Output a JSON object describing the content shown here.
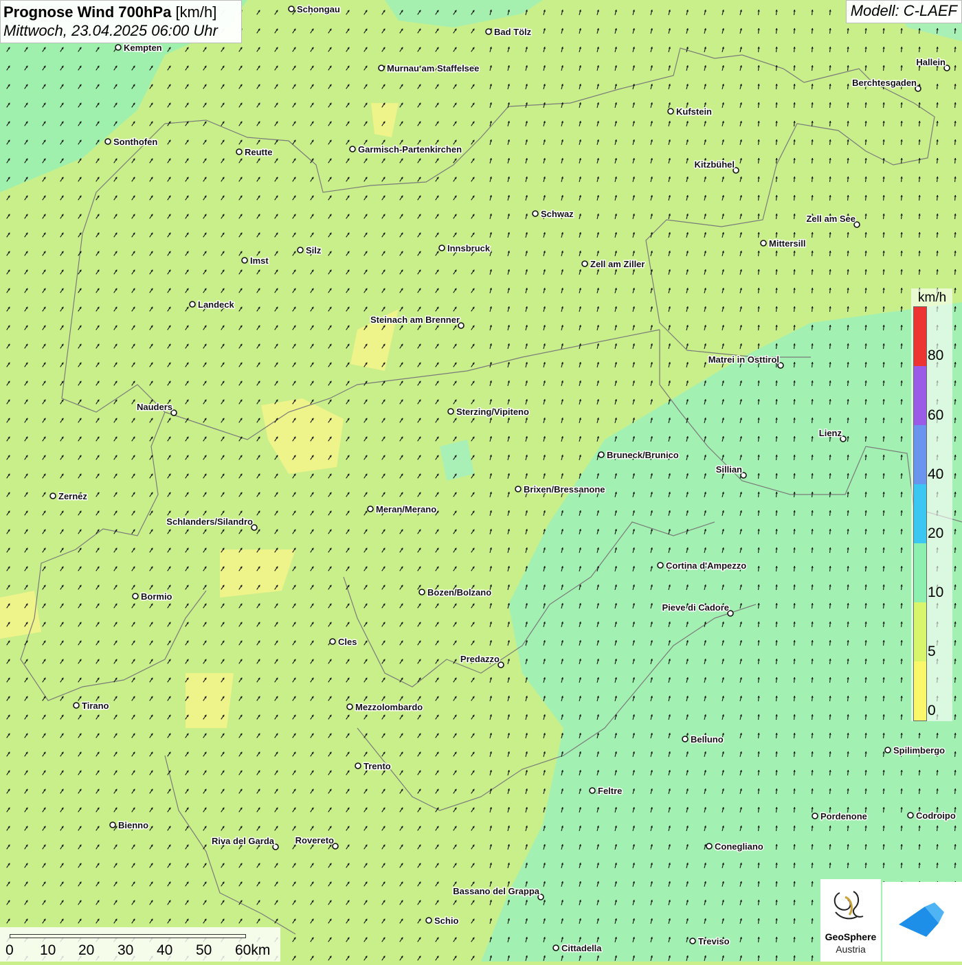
{
  "title": {
    "main_bold": "Prognose Wind 700hPa",
    "main_unit": "[km/h]",
    "datetime": "Mittwoch, 23.04.2025 06:00 Uhr"
  },
  "model": "Modell: C-LAEF",
  "legend": {
    "unit": "km/h",
    "ticks": [
      "80",
      "60",
      "40",
      "20",
      "10",
      "5",
      "0"
    ],
    "colors": [
      "#ee3333",
      "#9a5ce8",
      "#6a94ee",
      "#3cc6f2",
      "#8ef0b0",
      "#d8f56c",
      "#fbf76a"
    ]
  },
  "scale": {
    "labels": [
      "0",
      "10",
      "20",
      "30",
      "40",
      "50",
      "60km"
    ]
  },
  "cities": [
    {
      "name": "Schongau",
      "label_side": "right"
    },
    {
      "name": "Bad Tölz",
      "label_side": "right"
    },
    {
      "name": "Kempten",
      "label_side": "right"
    },
    {
      "name": "Murnau am Staffelsee",
      "label_side": "right"
    },
    {
      "name": "Hallein",
      "label_side": "left"
    },
    {
      "name": "Berchtesgaden",
      "label_side": "left"
    },
    {
      "name": "Kufstein",
      "label_side": "right"
    },
    {
      "name": "Sonthofen",
      "label_side": "right"
    },
    {
      "name": "Reutte",
      "label_side": "right"
    },
    {
      "name": "Garmisch-Partenkirchen",
      "label_side": "right"
    },
    {
      "name": "Kitzbühel",
      "label_side": "left"
    },
    {
      "name": "Schwaz",
      "label_side": "right"
    },
    {
      "name": "Zell am See",
      "label_side": "left"
    },
    {
      "name": "Mittersill",
      "label_side": "right"
    },
    {
      "name": "Innsbruck",
      "label_side": "right"
    },
    {
      "name": "Silz",
      "label_side": "right"
    },
    {
      "name": "Imst",
      "label_side": "right"
    },
    {
      "name": "Zell am Ziller",
      "label_side": "right"
    },
    {
      "name": "Landeck",
      "label_side": "right"
    },
    {
      "name": "Steinach am Brenner",
      "label_side": "left"
    },
    {
      "name": "Matrei in Osttirol",
      "label_side": "left"
    },
    {
      "name": "Nauders",
      "label_side": "left"
    },
    {
      "name": "Sterzing/Vipiteno",
      "label_side": "right"
    },
    {
      "name": "Lienz",
      "label_side": "left"
    },
    {
      "name": "Bruneck/Brunico",
      "label_side": "right"
    },
    {
      "name": "Sillian",
      "label_side": "left"
    },
    {
      "name": "Brixen/Bressanone",
      "label_side": "right"
    },
    {
      "name": "Zernez",
      "label_side": "right"
    },
    {
      "name": "Meran/Merano",
      "label_side": "right"
    },
    {
      "name": "Schlanders/Silandro",
      "label_side": "left"
    },
    {
      "name": "Cortina d'Ampezzo",
      "label_side": "right"
    },
    {
      "name": "Bozen/Bolzano",
      "label_side": "right"
    },
    {
      "name": "Bormio",
      "label_side": "right"
    },
    {
      "name": "Pieve di Cadore",
      "label_side": "left"
    },
    {
      "name": "Cles",
      "label_side": "right"
    },
    {
      "name": "Predazzo",
      "label_side": "left"
    },
    {
      "name": "Tirano",
      "label_side": "right"
    },
    {
      "name": "Mezzolombardo",
      "label_side": "right"
    },
    {
      "name": "Belluno",
      "label_side": "right"
    },
    {
      "name": "Spilimbergo",
      "label_side": "right"
    },
    {
      "name": "Trento",
      "label_side": "right"
    },
    {
      "name": "Feltre",
      "label_side": "right"
    },
    {
      "name": "Pordenone",
      "label_side": "right"
    },
    {
      "name": "Codroipo",
      "label_side": "right"
    },
    {
      "name": "Bienno",
      "label_side": "right"
    },
    {
      "name": "Riva del Garda",
      "label_side": "left"
    },
    {
      "name": "Rovereto",
      "label_side": "left"
    },
    {
      "name": "Conegliano",
      "label_side": "right"
    },
    {
      "name": "Bassano del Grappa",
      "label_side": "left"
    },
    {
      "name": "Schio",
      "label_side": "right"
    },
    {
      "name": "Treviso",
      "label_side": "right"
    },
    {
      "name": "Cittadella",
      "label_side": "right"
    }
  ],
  "logos": {
    "geosphere_name": "GeoSphere",
    "geosphere_sub": "Austria"
  }
}
